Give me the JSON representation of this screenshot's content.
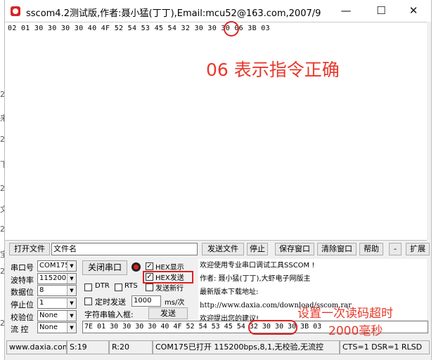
{
  "window": {
    "title": "sscom4.2测试版,作者:聂小猛(丁丁),Email:mcu52@163.com,2007/9",
    "minimize": "—",
    "maximize": "☐",
    "close": "✕"
  },
  "receive": {
    "text": "02 01 30 30 30 30 40 4F 52 54 53 45 54 32 30 30 30 06 3B 03",
    "annotation": "06 表示指令正确"
  },
  "toolbar": {
    "open_file": "打开文件",
    "file_name": "文件名",
    "send_file": "发送文件",
    "stop": "停止",
    "save_window": "保存窗口",
    "clear_window": "清除窗口",
    "help": "帮助",
    "minus": "-",
    "expand": "扩展"
  },
  "settings": {
    "port_label": "串口号",
    "port_value": "COM175",
    "baud_label": "波特率",
    "baud_value": "115200",
    "databits_label": "数据位",
    "databits_value": "8",
    "stopbits_label": "停止位",
    "stopbits_value": "1",
    "parity_label": "校验位",
    "parity_value": "None",
    "flow_label": "流 控",
    "flow_value": "None",
    "close_port": "关闭串口",
    "hex_display": "HEX显示",
    "hex_send": "HEX发送",
    "send_newline": "发送新行",
    "dtr": "DTR",
    "rts": "RTS",
    "timed_send": "定时发送",
    "timed_value": "1000",
    "timed_unit": "ms/次",
    "input_label": "字符串输入框:",
    "send": "发送",
    "send_text": "7E 01 30 30 30 30 40 4F 52 54 53 45 54 32 30 30 30 3B 03"
  },
  "info": {
    "line1": "欢迎使用专业串口调试工具SSCOM !",
    "line2": "作者: 聂小猛(丁丁),大虾电子网版主",
    "line3": "最新版本下载地址:",
    "line4": "http://www.daxia.com/download/sscom.rar",
    "line5": "欢迎提出您的建议!"
  },
  "annotation2": {
    "line1": "设置一次读码超时",
    "line2": "2000毫秒"
  },
  "statusbar": {
    "site": "www.daxia.com",
    "sent": "S:19",
    "received": "R:20",
    "port_status": "COM175已打开  115200bps,8,1,无校验,无流控",
    "lines": "CTS=1 DSR=1 RLSD"
  },
  "side_fragments": [
    "2",
    "2",
    "来",
    "2",
    "下",
    "2",
    "文",
    "2",
    "宝",
    "2"
  ],
  "colors": {
    "accent_red": "#e8382b",
    "circle_red": "#e02020"
  }
}
